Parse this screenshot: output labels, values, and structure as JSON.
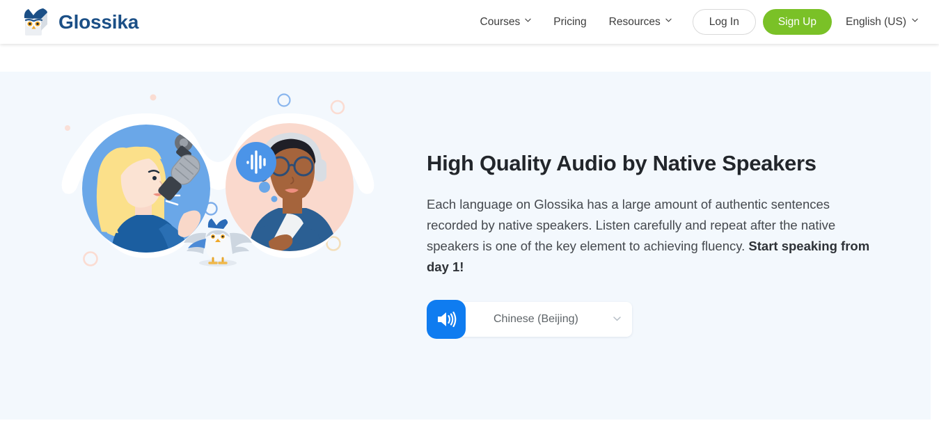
{
  "header": {
    "brand": {
      "name": "Glossika",
      "logo_icon": "owl-logo-icon",
      "color": "#1b4f86"
    },
    "nav_items": [
      {
        "label": "Courses",
        "has_dropdown": true
      },
      {
        "label": "Pricing",
        "has_dropdown": false
      },
      {
        "label": "Resources",
        "has_dropdown": true
      }
    ],
    "login_label": "Log In",
    "signup_label": "Sign Up",
    "signup_color": "#7ac127",
    "language_label": "English (US)",
    "language_has_dropdown": true
  },
  "hero": {
    "background_color": "#f3f8fd",
    "title": "High Quality Audio by Native Speakers",
    "paragraph_part1": "Each language on Glossika has a large amount of authentic sentences recorded by native speakers. Listen carefully and repeat after the native speakers is one of the key element to achieving fluency. ",
    "paragraph_bold": "Start speaking from day 1!",
    "audio": {
      "play_icon": "speaker-volume-icon",
      "play_button_color": "#0f7cf0",
      "selected_language": "Chinese (Beijing)",
      "dropdown_icon": "chevron-down-icon"
    },
    "illustration": {
      "name": "native-speakers-illustration",
      "left_scene": "woman-speaking-into-microphone",
      "right_scene": "man-listening-with-headphones",
      "mascot": "owl-mascot",
      "left_circle_color": "#6aa7e8",
      "right_circle_color": "#fad9cd"
    }
  }
}
